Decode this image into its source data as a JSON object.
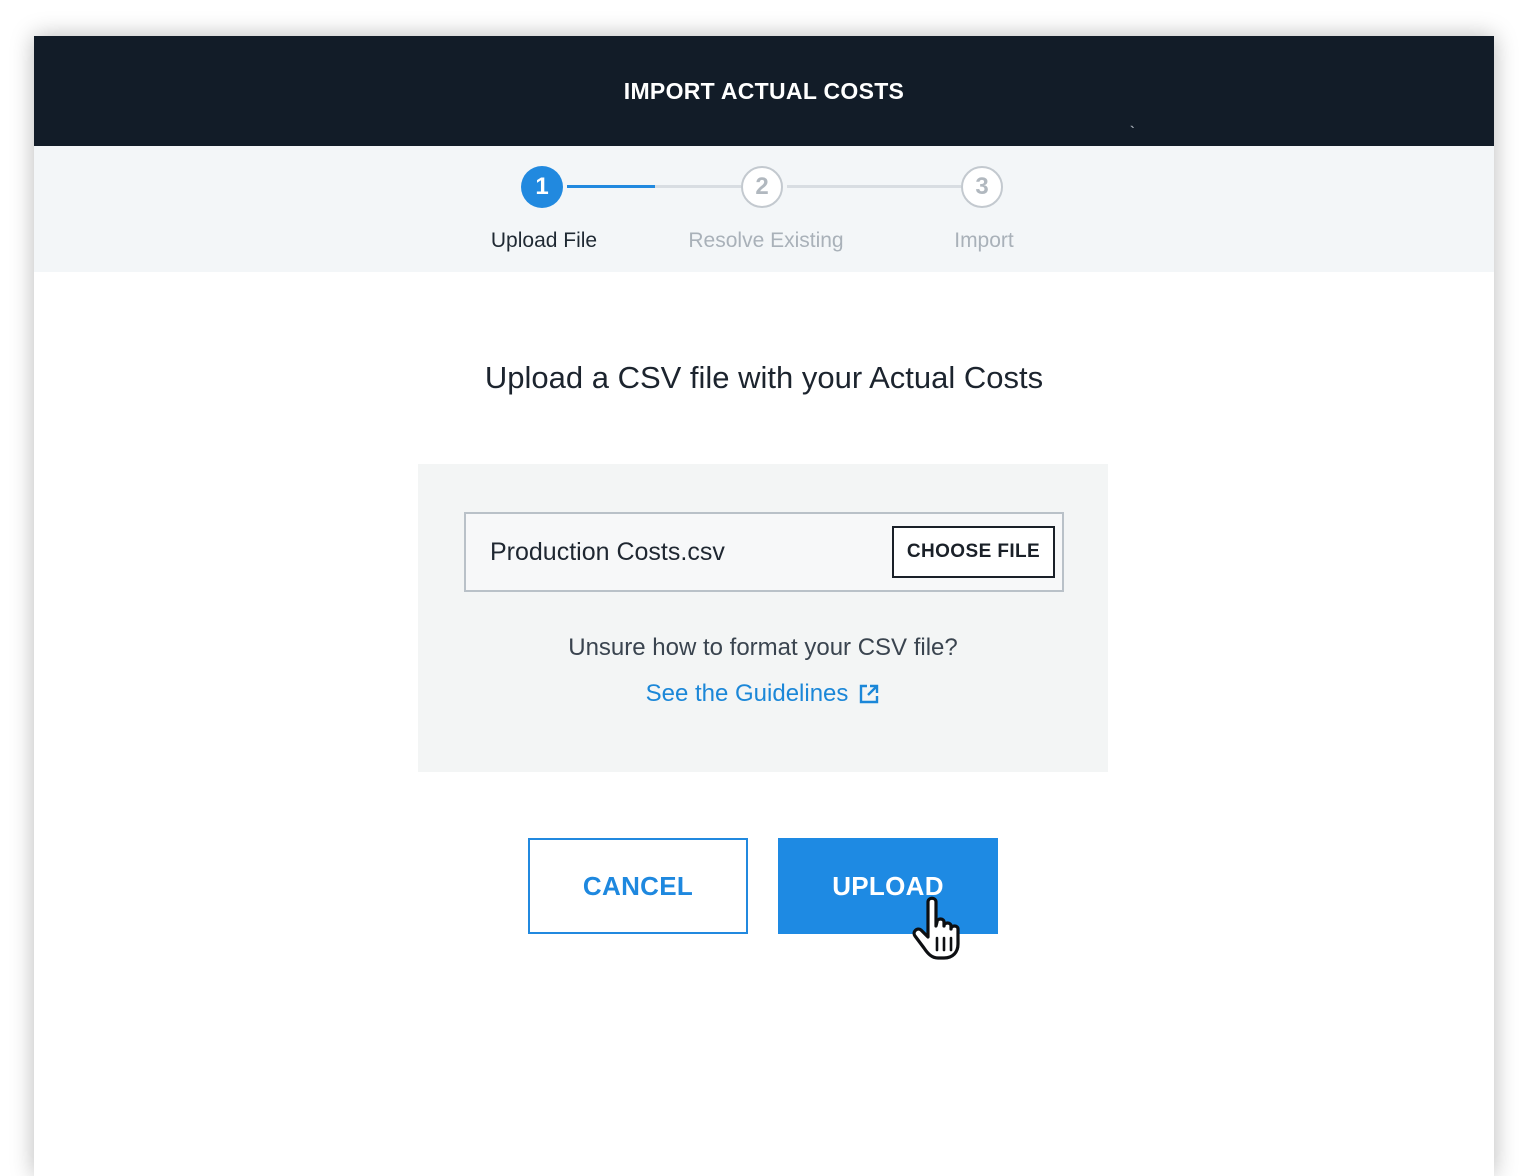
{
  "dialog": {
    "title": "IMPORT ACTUAL COSTS",
    "header_mark": "`"
  },
  "stepper": {
    "steps": [
      {
        "number": "1",
        "label": "Upload File",
        "state": "active"
      },
      {
        "number": "2",
        "label": "Resolve Existing",
        "state": "inactive"
      },
      {
        "number": "3",
        "label": "Import",
        "state": "inactive"
      }
    ]
  },
  "main": {
    "heading": "Upload a CSV file with your Actual Costs",
    "file_input": {
      "value": "Production Costs.csv",
      "choose_label": "CHOOSE FILE"
    },
    "help_text": "Unsure how to format your CSV file?",
    "guidelines_link": "See the Guidelines",
    "guidelines_icon": "external-link-icon"
  },
  "actions": {
    "cancel_label": "CANCEL",
    "upload_label": "UPLOAD"
  },
  "colors": {
    "header_bg": "#121c28",
    "accent": "#1e8ae3",
    "stepper_bg": "#f3f6f8",
    "panel_bg": "#f3f5f5"
  }
}
